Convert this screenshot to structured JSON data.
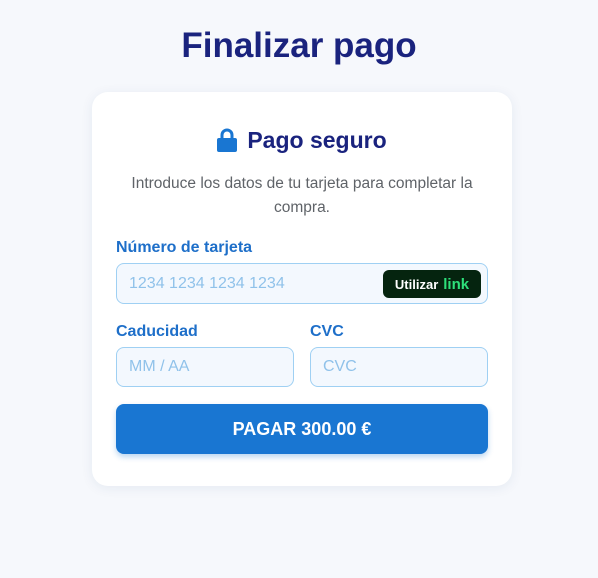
{
  "page": {
    "title": "Finalizar pago"
  },
  "card": {
    "title": "Pago seguro",
    "title_icon": "lock-icon",
    "description": "Introduce los datos de tu tarjeta para completar la compra."
  },
  "form": {
    "card_number": {
      "label": "Número de tarjeta",
      "placeholder": "1234 1234 1234 1234",
      "value": ""
    },
    "link_button": {
      "label": "Utilizar",
      "brand": "link"
    },
    "expiry": {
      "label": "Caducidad",
      "placeholder": "MM / AA",
      "value": ""
    },
    "cvc": {
      "label": "CVC",
      "placeholder": "CVC",
      "value": ""
    },
    "pay_button": {
      "label": "PAGAR 300.00 €"
    }
  },
  "colors": {
    "title": "#1a237e",
    "accent": "#1976d2",
    "label": "#1e6fc9",
    "link_bg": "#05240f",
    "link_brand": "#2ee07a"
  }
}
